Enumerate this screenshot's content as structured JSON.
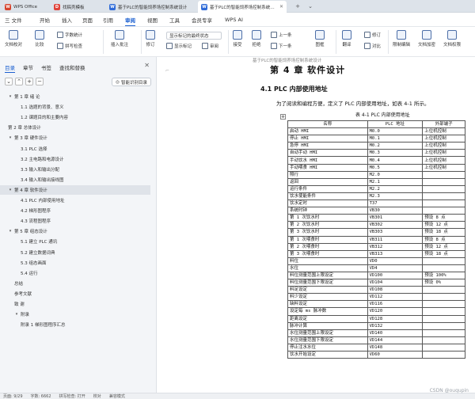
{
  "tabs": [
    {
      "label": "WPS Office",
      "icon": "wps-logo-icon",
      "color": "#d6452f"
    },
    {
      "label": "找稿壳模板",
      "icon": "template-icon",
      "color": "#e0433a"
    },
    {
      "label": "基于PLC的智能饲养场控制系统设计",
      "icon": "doc-icon",
      "color": "#2f6bd8"
    },
    {
      "label": "基于PLC的智能饲养场控制系统设...",
      "icon": "doc-icon",
      "color": "#2f6bd8"
    }
  ],
  "menu": [
    "三 文件",
    "开始",
    "插入",
    "页面",
    "引用",
    "审阅",
    "视图",
    "工具",
    "会员专享",
    "WPS AI"
  ],
  "menu_active": "审阅",
  "toolbar": {
    "items": [
      "文档校对",
      "比较",
      "修改",
      "字数统计",
      "拼写检查",
      "插入批注",
      "修订",
      "显示标记",
      "显示标记的最终状态",
      "审阅",
      "接受",
      "拒绝",
      "上一条",
      "下一条",
      "图框",
      "翻译",
      "修订",
      "对比",
      "限制编辑",
      "文档加密",
      "文档权限"
    ]
  },
  "nav": {
    "tabs": [
      "目录",
      "章节",
      "书签",
      "查找和替换"
    ],
    "smart_button": "智能识别目录",
    "toc": [
      {
        "level": 1,
        "label": "第 1 章  绪  论",
        "expanded": true
      },
      {
        "level": 2,
        "label": "1.1 选题的背景、意义"
      },
      {
        "level": 2,
        "label": "1.2 课题目的和主要内容"
      },
      {
        "level": 1,
        "label": "第 2 章  总体设计"
      },
      {
        "level": 1,
        "label": "第 3 章  硬件设计",
        "expanded": true
      },
      {
        "level": 2,
        "label": "3.1 PLC 选择"
      },
      {
        "level": 2,
        "label": "3.2 主电路和电源设计"
      },
      {
        "level": 2,
        "label": "3.3 输入和输出分配"
      },
      {
        "level": 2,
        "label": "3.4 输入和输出接线图"
      },
      {
        "level": 1,
        "label": "第 4 章  软件设计",
        "expanded": true,
        "selected": true
      },
      {
        "level": 2,
        "label": "4.1 PLC 内部使用地址"
      },
      {
        "level": 2,
        "label": "4.2 梯形图程序"
      },
      {
        "level": 2,
        "label": "4.3 流程图程序"
      },
      {
        "level": 1,
        "label": "第 5 章  组态设计",
        "expanded": true
      },
      {
        "level": 2,
        "label": "5.1 建立 PLC 通讯"
      },
      {
        "level": 2,
        "label": "5.2 建立数据词典"
      },
      {
        "level": 2,
        "label": "5.3 组态画面"
      },
      {
        "level": 2,
        "label": "5.4 运行"
      },
      {
        "level": 0,
        "label": "总结"
      },
      {
        "level": 0,
        "label": "参考文献"
      },
      {
        "level": 0,
        "label": "致  谢"
      },
      {
        "level": 0,
        "label": "附录",
        "expanded": true
      },
      {
        "level": 2,
        "label": "附录 1  梯形图程序汇总"
      }
    ]
  },
  "document": {
    "header": "基于PLC的智能饲养场控制系统设计",
    "chapter": "第 4 章   软件设计",
    "section": "4.1 PLC 内部使用地址",
    "paragraph": "为了阅读和编程方便，定义了 PLC 内部使用地址，如表 4-1 所示。",
    "table_caption": "表 4-1 PLC 内部使用地址",
    "table_headers": [
      "名称",
      "PLC 地址",
      "外部端子"
    ],
    "table_rows": [
      [
        "启动 HMI",
        "M0.0",
        "上位机控制"
      ],
      [
        "停止 HMI",
        "M0.1",
        "上位机控制"
      ],
      [
        "急停 HMI",
        "M0.2",
        "上位机控制"
      ],
      [
        "自动手动 HMI",
        "M0.3",
        "上位机控制"
      ],
      [
        "手动饮水 HMI",
        "M0.4",
        "上位机控制"
      ],
      [
        "手动喂食 HMI",
        "M0.5",
        "上位机控制"
      ],
      [
        "照行",
        "M2.0",
        ""
      ],
      [
        "返回",
        "M2.1",
        ""
      ],
      [
        "运行条件",
        "M2.2",
        ""
      ],
      [
        "饮水使能条件",
        "M2.3",
        ""
      ],
      [
        "饮水定时",
        "T37",
        ""
      ],
      [
        "系统时钟",
        "VB30",
        ""
      ],
      [
        "第 1 次饮水时",
        "VB301",
        "预设 8 点"
      ],
      [
        "第 2 次饮水时",
        "VB302",
        "预设 12 点"
      ],
      [
        "第 3 次饮水时",
        "VB303",
        "预设 18 点"
      ],
      [
        "第 1 次喂食时",
        "VB311",
        "预设 8 点"
      ],
      [
        "第 2 次喂食时",
        "VB312",
        "预设 12 点"
      ],
      [
        "第 3 次喂食时",
        "VB313",
        "预设 18 点"
      ],
      [
        "料位",
        "VD0",
        ""
      ],
      [
        "水位",
        "VD4",
        ""
      ],
      [
        "料位测量范围上限设定",
        "VD100",
        "预设 100%"
      ],
      [
        "料位测量范围下限设定",
        "VD104",
        "预设 0%"
      ],
      [
        "料足设定",
        "VD108",
        ""
      ],
      [
        "料少设定",
        "VD112",
        ""
      ],
      [
        "缺料设定",
        "VD116",
        ""
      ],
      [
        "设定每 ms 脉冲数",
        "VD120",
        ""
      ],
      [
        "距离设定",
        "VD128",
        ""
      ],
      [
        "脉冲计算",
        "VD132",
        ""
      ],
      [
        "水位测量范围上限设定",
        "VD140",
        ""
      ],
      [
        "水位测量范围下限设定",
        "VD144",
        ""
      ],
      [
        "停止注水水位",
        "VD148",
        ""
      ],
      [
        "饮水开始设定",
        "VD60",
        ""
      ]
    ]
  },
  "status_bar": [
    "页面: 9/29",
    "字数: 6662",
    "拼写检查: 打开",
    "校对",
    "兼容模式"
  ],
  "watermark": "CSDN @ouqupin",
  "colors": {
    "accent": "#1a5fd0",
    "tabbar": "#dde3ea",
    "nav_bg": "#f3f5f8"
  }
}
